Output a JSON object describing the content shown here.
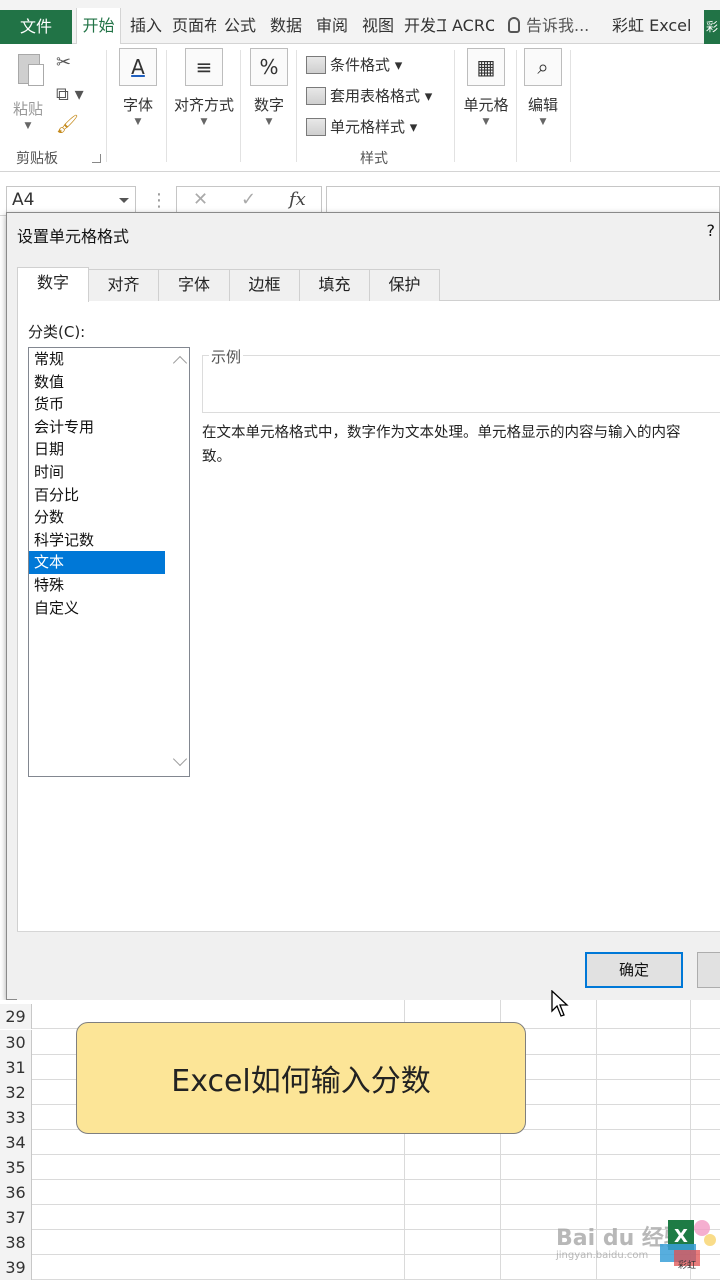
{
  "ribbon": {
    "tabs": [
      {
        "label": "文件",
        "key": "file"
      },
      {
        "label": "开始",
        "key": "home"
      },
      {
        "label": "插入",
        "key": "insert"
      },
      {
        "label": "页面布",
        "key": "page-layout"
      },
      {
        "label": "公式",
        "key": "formulas"
      },
      {
        "label": "数据",
        "key": "data"
      },
      {
        "label": "审阅",
        "key": "review"
      },
      {
        "label": "视图",
        "key": "view"
      },
      {
        "label": "开发工",
        "key": "developer"
      },
      {
        "label": "ACROBAT",
        "key": "acrobat"
      }
    ],
    "tell_me": "告诉我...",
    "user_name": "彩虹 Excel",
    "user_initial": "彩",
    "groups": {
      "clipboard": {
        "label": "剪贴板",
        "paste": "粘贴"
      },
      "font": {
        "label": "字体"
      },
      "alignment": {
        "label": "对齐方式"
      },
      "number": {
        "label": "数字"
      },
      "styles": {
        "label": "样式",
        "conditional": "条件格式",
        "table": "套用表格格式",
        "cell_styles": "单元格样式"
      },
      "cells": {
        "label": "单元格"
      },
      "editing": {
        "label": "编辑"
      }
    },
    "accent": "#217346"
  },
  "formula_bar": {
    "name_box": "A4",
    "fx": "fx"
  },
  "dialog": {
    "title": "设置单元格格式",
    "help": "?",
    "tabs": [
      {
        "label": "数字",
        "active": true
      },
      {
        "label": "对齐",
        "active": false
      },
      {
        "label": "字体",
        "active": false
      },
      {
        "label": "边框",
        "active": false
      },
      {
        "label": "填充",
        "active": false
      },
      {
        "label": "保护",
        "active": false
      }
    ],
    "category_label": "分类(C):",
    "categories": [
      "常规",
      "数值",
      "货币",
      "会计专用",
      "日期",
      "时间",
      "百分比",
      "分数",
      "科学记数",
      "文本",
      "特殊",
      "自定义"
    ],
    "selected_category": "文本",
    "sample_label": "示例",
    "description_line1": "在文本单元格格式中，数字作为文本处理。单元格显示的内容与输入的内容",
    "description_line2": "致。",
    "ok_label": "确定",
    "select_color": "#0078d7"
  },
  "grid": {
    "rows": [
      "29",
      "30",
      "31",
      "32",
      "33",
      "34",
      "35",
      "36",
      "37",
      "38",
      "39"
    ]
  },
  "caption": {
    "text": "Excel如何输入分数",
    "background": "#fce597"
  },
  "watermark": {
    "brand": "Bai du 经验",
    "url": "jingyan.baidu.com",
    "logo_text": "彩虹"
  }
}
